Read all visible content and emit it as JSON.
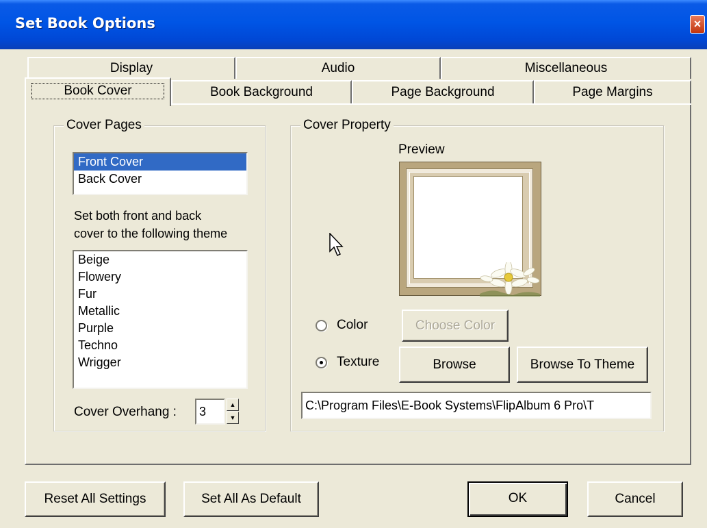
{
  "window": {
    "title": "Set Book Options",
    "close_glyph": "×"
  },
  "tabs": {
    "row1": [
      "Display",
      "Audio",
      "Miscellaneous"
    ],
    "row2": [
      "Book Cover",
      "Book Background",
      "Page Background",
      "Page Margins"
    ],
    "active": "Book Cover"
  },
  "cover_pages": {
    "legend": "Cover Pages",
    "pages": [
      "Front Cover",
      "Back Cover"
    ],
    "selected_page": "Front Cover",
    "theme_caption_line1": "Set both front and back",
    "theme_caption_line2": "cover to the following theme",
    "themes": [
      "Beige",
      "Flowery",
      "Fur",
      "Metallic",
      "Purple",
      "Techno",
      "Wrigger"
    ],
    "overhang_label": "Cover Overhang :",
    "overhang_value": "3",
    "spin_up": "▲",
    "spin_down": "▼"
  },
  "cover_property": {
    "legend": "Cover Property",
    "preview_label": "Preview",
    "color_label": "Color",
    "texture_label": "Texture",
    "selected_option": "Texture",
    "choose_color_label": "Choose Color",
    "browse_label": "Browse",
    "browse_theme_label": "Browse To Theme",
    "path_value": "C:\\Program Files\\E-Book Systems\\FlipAlbum 6 Pro\\T"
  },
  "footer": {
    "reset_label": "Reset All Settings",
    "default_label": "Set All As Default",
    "ok_label": "OK",
    "cancel_label": "Cancel"
  },
  "icons": {
    "close": "close-icon",
    "cursor": "mouse-pointer-icon",
    "flower": "daisy-flower-icon"
  },
  "colors": {
    "titlebar": "#0055e5",
    "selection": "#316ac5",
    "face": "#ece9d8",
    "preview_frame": "#b9a67e"
  }
}
